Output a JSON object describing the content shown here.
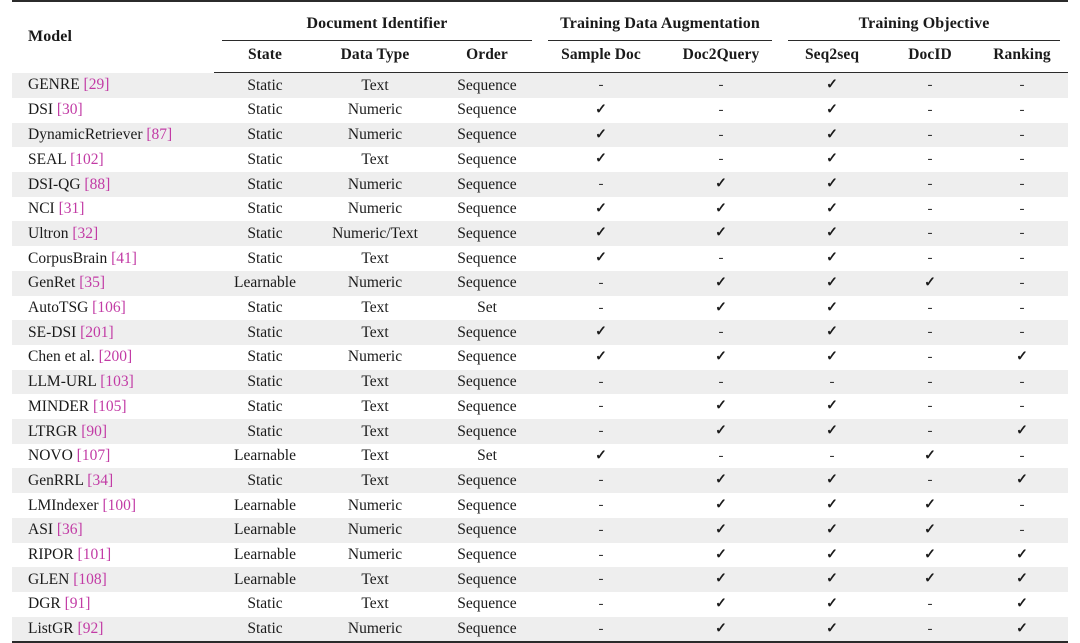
{
  "table": {
    "groups": [
      {
        "label": "",
        "span": 1
      },
      {
        "label": "Document Identifier",
        "span": 3
      },
      {
        "label": "Training Data Augmentation",
        "span": 2
      },
      {
        "label": "Training Objective",
        "span": 3
      }
    ],
    "columns": [
      "Model",
      "State",
      "Data Type",
      "Order",
      "Sample Doc",
      "Doc2Query",
      "Seq2seq",
      "DocID",
      "Ranking"
    ],
    "symbols": {
      "check": "✓",
      "dash": "-"
    },
    "accent_color": "#c23ba5",
    "rows": [
      {
        "model": "GENRE",
        "cite": "[29]",
        "state": "Static",
        "dtype": "Text",
        "order": "Sequence",
        "sample": "-",
        "d2q": "-",
        "seq": "✓",
        "docid": "-",
        "rank": "-"
      },
      {
        "model": "DSI",
        "cite": "[30]",
        "state": "Static",
        "dtype": "Numeric",
        "order": "Sequence",
        "sample": "✓",
        "d2q": "-",
        "seq": "✓",
        "docid": "-",
        "rank": "-"
      },
      {
        "model": "DynamicRetriever",
        "cite": "[87]",
        "state": "Static",
        "dtype": "Numeric",
        "order": "Sequence",
        "sample": "✓",
        "d2q": "-",
        "seq": "✓",
        "docid": "-",
        "rank": "-"
      },
      {
        "model": "SEAL",
        "cite": "[102]",
        "state": "Static",
        "dtype": "Text",
        "order": "Sequence",
        "sample": "✓",
        "d2q": "-",
        "seq": "✓",
        "docid": "-",
        "rank": "-"
      },
      {
        "model": "DSI-QG",
        "cite": "[88]",
        "state": "Static",
        "dtype": "Numeric",
        "order": "Sequence",
        "sample": "-",
        "d2q": "✓",
        "seq": "✓",
        "docid": "-",
        "rank": "-"
      },
      {
        "model": "NCI",
        "cite": "[31]",
        "state": "Static",
        "dtype": "Numeric",
        "order": "Sequence",
        "sample": "✓",
        "d2q": "✓",
        "seq": "✓",
        "docid": "-",
        "rank": "-"
      },
      {
        "model": "Ultron",
        "cite": "[32]",
        "state": "Static",
        "dtype": "Numeric/Text",
        "order": "Sequence",
        "sample": "✓",
        "d2q": "✓",
        "seq": "✓",
        "docid": "-",
        "rank": "-"
      },
      {
        "model": "CorpusBrain",
        "cite": "[41]",
        "state": "Static",
        "dtype": "Text",
        "order": "Sequence",
        "sample": "✓",
        "d2q": "-",
        "seq": "✓",
        "docid": "-",
        "rank": "-"
      },
      {
        "model": "GenRet",
        "cite": "[35]",
        "state": "Learnable",
        "dtype": "Numeric",
        "order": "Sequence",
        "sample": "-",
        "d2q": "✓",
        "seq": "✓",
        "docid": "✓",
        "rank": "-"
      },
      {
        "model": "AutoTSG",
        "cite": "[106]",
        "state": "Static",
        "dtype": "Text",
        "order": "Set",
        "sample": "-",
        "d2q": "✓",
        "seq": "✓",
        "docid": "-",
        "rank": "-"
      },
      {
        "model": "SE-DSI",
        "cite": "[201]",
        "state": "Static",
        "dtype": "Text",
        "order": "Sequence",
        "sample": "✓",
        "d2q": "-",
        "seq": "✓",
        "docid": "-",
        "rank": "-"
      },
      {
        "model": "Chen et al.",
        "cite": "[200]",
        "state": "Static",
        "dtype": "Numeric",
        "order": "Sequence",
        "sample": "✓",
        "d2q": "✓",
        "seq": "✓",
        "docid": "-",
        "rank": "✓"
      },
      {
        "model": "LLM-URL",
        "cite": "[103]",
        "state": "Static",
        "dtype": "Text",
        "order": "Sequence",
        "sample": "-",
        "d2q": "-",
        "seq": "-",
        "docid": "-",
        "rank": "-"
      },
      {
        "model": "MINDER",
        "cite": "[105]",
        "state": "Static",
        "dtype": "Text",
        "order": "Sequence",
        "sample": "-",
        "d2q": "✓",
        "seq": "✓",
        "docid": "-",
        "rank": "-"
      },
      {
        "model": "LTRGR",
        "cite": "[90]",
        "state": "Static",
        "dtype": "Text",
        "order": "Sequence",
        "sample": "-",
        "d2q": "✓",
        "seq": "✓",
        "docid": "-",
        "rank": "✓"
      },
      {
        "model": "NOVO",
        "cite": "[107]",
        "state": "Learnable",
        "dtype": "Text",
        "order": "Set",
        "sample": "✓",
        "d2q": "-",
        "seq": "-",
        "docid": "✓",
        "rank": "-"
      },
      {
        "model": "GenRRL",
        "cite": "[34]",
        "state": "Static",
        "dtype": "Text",
        "order": "Sequence",
        "sample": "-",
        "d2q": "✓",
        "seq": "✓",
        "docid": "-",
        "rank": "✓"
      },
      {
        "model": "LMIndexer",
        "cite": "[100]",
        "state": "Learnable",
        "dtype": "Numeric",
        "order": "Sequence",
        "sample": "-",
        "d2q": "✓",
        "seq": "✓",
        "docid": "✓",
        "rank": "-"
      },
      {
        "model": "ASI",
        "cite": "[36]",
        "state": "Learnable",
        "dtype": "Numeric",
        "order": "Sequence",
        "sample": "-",
        "d2q": "✓",
        "seq": "✓",
        "docid": "✓",
        "rank": "-"
      },
      {
        "model": "RIPOR",
        "cite": "[101]",
        "state": "Learnable",
        "dtype": "Numeric",
        "order": "Sequence",
        "sample": "-",
        "d2q": "✓",
        "seq": "✓",
        "docid": "✓",
        "rank": "✓"
      },
      {
        "model": "GLEN",
        "cite": "[108]",
        "state": "Learnable",
        "dtype": "Text",
        "order": "Sequence",
        "sample": "-",
        "d2q": "✓",
        "seq": "✓",
        "docid": "✓",
        "rank": "✓"
      },
      {
        "model": "DGR",
        "cite": "[91]",
        "state": "Static",
        "dtype": "Text",
        "order": "Sequence",
        "sample": "-",
        "d2q": "✓",
        "seq": "✓",
        "docid": "-",
        "rank": "✓"
      },
      {
        "model": "ListGR",
        "cite": "[92]",
        "state": "Static",
        "dtype": "Numeric",
        "order": "Sequence",
        "sample": "-",
        "d2q": "✓",
        "seq": "✓",
        "docid": "-",
        "rank": "✓"
      }
    ]
  }
}
